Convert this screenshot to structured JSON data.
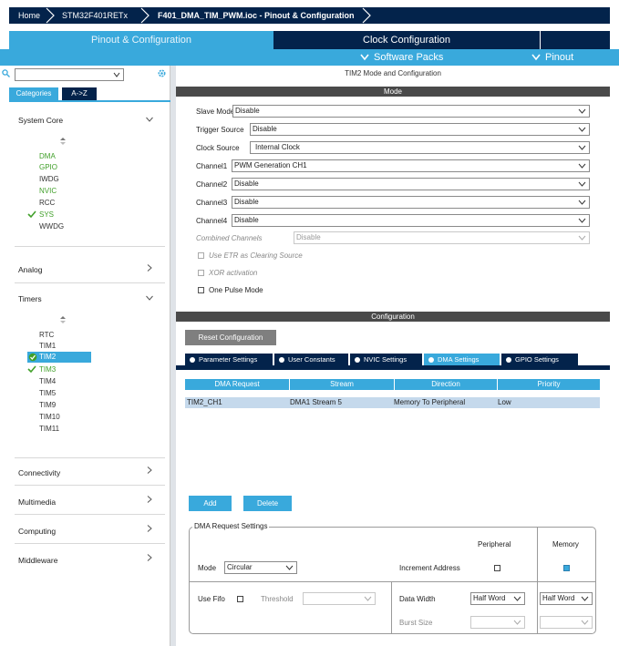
{
  "breadcrumb": {
    "home": "Home",
    "device": "STM32F401RETx",
    "project": "F401_DMA_TIM_PWM.ioc - Pinout & Configuration"
  },
  "main_tabs": {
    "pinout": "Pinout & Configuration",
    "clock": "Clock Configuration"
  },
  "sub_tabs": {
    "software_packs": "Software Packs",
    "pinout": "Pinout"
  },
  "left": {
    "search_value": "",
    "categories_tab": "Categories",
    "az_tab": "A->Z",
    "sections": {
      "system_core": "System Core",
      "analog": "Analog",
      "timers": "Timers",
      "connectivity": "Connectivity",
      "multimedia": "Multimedia",
      "computing": "Computing",
      "middleware": "Middleware"
    },
    "system_core_items": [
      "DMA",
      "GPIO",
      "IWDG",
      "NVIC",
      "RCC",
      "SYS",
      "WWDG"
    ],
    "timer_items": [
      "RTC",
      "TIM1",
      "TIM2",
      "TIM3",
      "TIM4",
      "TIM5",
      "TIM9",
      "TIM10",
      "TIM11"
    ]
  },
  "right": {
    "title": "TIM2 Mode and Configuration",
    "mode_header": "Mode",
    "fields": {
      "slave_mode": {
        "label": "Slave Mode",
        "value": "Disable"
      },
      "trigger_source": {
        "label": "Trigger Source",
        "value": "Disable"
      },
      "clock_source": {
        "label": "Clock Source",
        "value": "Internal Clock"
      },
      "channel1": {
        "label": "Channel1",
        "value": "PWM Generation CH1"
      },
      "channel2": {
        "label": "Channel2",
        "value": "Disable"
      },
      "channel3": {
        "label": "Channel3",
        "value": "Disable"
      },
      "channel4": {
        "label": "Channel4",
        "value": "Disable"
      },
      "combined_channels": {
        "label": "Combined Channels",
        "value": "Disable"
      }
    },
    "checkboxes": {
      "use_etr": "Use ETR as Clearing Source",
      "xor": "XOR activation",
      "one_pulse": "One Pulse Mode"
    },
    "config_header": "Configuration",
    "reset_button": "Reset Configuration",
    "config_tabs": [
      "Parameter Settings",
      "User Constants",
      "NVIC Settings",
      "DMA Settings",
      "GPIO Settings"
    ],
    "dma_table": {
      "headers": [
        "DMA Request",
        "Stream",
        "Direction",
        "Priority"
      ],
      "rows": [
        [
          "TIM2_CH1",
          "DMA1 Stream 5",
          "Memory To Peripheral",
          "Low"
        ]
      ]
    },
    "add_button": "Add",
    "delete_button": "Delete",
    "dma_settings": {
      "group_title": "DMA Request Settings",
      "peripheral_header": "Peripheral",
      "memory_header": "Memory",
      "mode_label": "Mode",
      "mode_value": "Circular",
      "increment_label": "Increment Address",
      "use_fifo_label": "Use Fifo",
      "threshold_label": "Threshold",
      "data_width_label": "Data Width",
      "data_width_peripheral": "Half Word",
      "data_width_memory": "Half Word",
      "burst_size_label": "Burst Size"
    }
  },
  "colors": {
    "navy": "#03234b",
    "accent": "#39a9dc",
    "green": "#41a02a"
  }
}
